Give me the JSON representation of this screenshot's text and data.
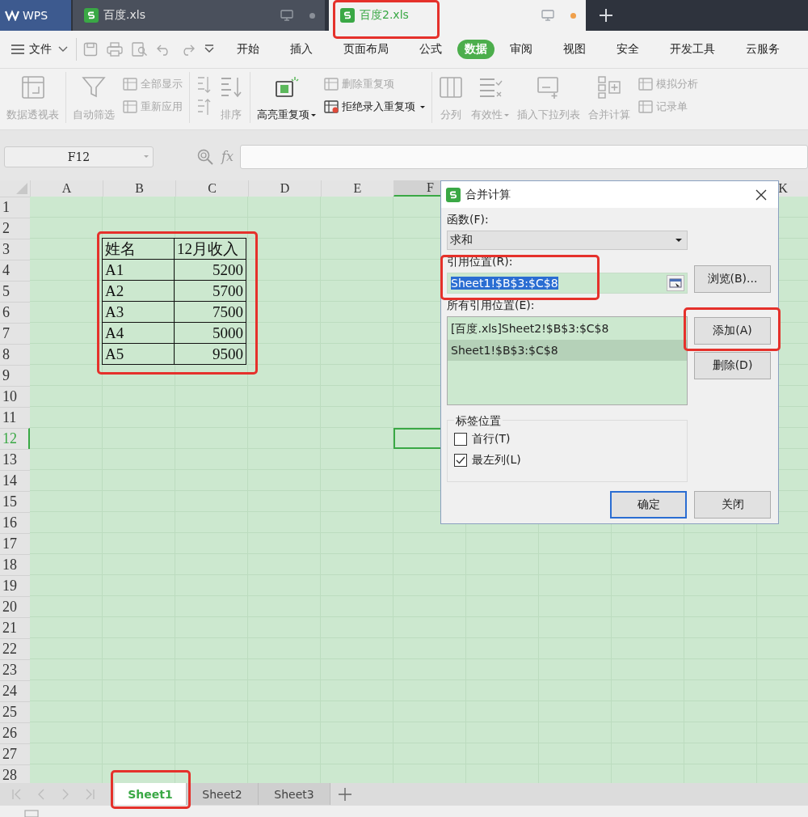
{
  "tabs": [
    {
      "kind": "home",
      "label": "WPS",
      "selected": false
    },
    {
      "kind": "file",
      "label": "百度.xls",
      "selected": false,
      "modified": false
    },
    {
      "kind": "file",
      "label": "百度2.xls",
      "selected": true,
      "modified": true
    }
  ],
  "menu": {
    "file_label": "文件",
    "ribbon_tabs": [
      {
        "label": "开始",
        "selected": false
      },
      {
        "label": "插入",
        "selected": false
      },
      {
        "label": "页面布局",
        "selected": false
      },
      {
        "label": "公式",
        "selected": false
      },
      {
        "label": "数据",
        "selected": true
      },
      {
        "label": "审阅",
        "selected": false
      },
      {
        "label": "视图",
        "selected": false
      },
      {
        "label": "安全",
        "selected": false
      },
      {
        "label": "开发工具",
        "selected": false
      },
      {
        "label": "云服务",
        "selected": false
      }
    ]
  },
  "ribbon": {
    "groups": [
      {
        "items": [
          {
            "kind": "big",
            "label": "数据透视表",
            "disabled": true,
            "dropdown": false
          }
        ]
      },
      {
        "items": [
          {
            "kind": "big",
            "label": "自动筛选",
            "disabled": true,
            "dropdown": false
          },
          {
            "kind": "stack",
            "items": [
              {
                "label": "全部显示",
                "disabled": true,
                "dropdown": false
              },
              {
                "label": "重新应用",
                "disabled": true,
                "dropdown": false
              }
            ]
          }
        ]
      },
      {
        "items": [
          {
            "kind": "sort_icons",
            "disabled": true
          },
          {
            "kind": "big",
            "label": "排序",
            "disabled": true,
            "dropdown": false
          }
        ]
      },
      {
        "items": [
          {
            "kind": "big",
            "label": "高亮重复项",
            "disabled": false,
            "dropdown": true
          },
          {
            "kind": "stack",
            "items": [
              {
                "label": "删除重复项",
                "disabled": true,
                "dropdown": false
              },
              {
                "label": "拒绝录入重复项",
                "disabled": false,
                "dropdown": true
              }
            ]
          }
        ]
      },
      {
        "items": [
          {
            "kind": "big",
            "label": "分列",
            "disabled": true,
            "dropdown": false
          },
          {
            "kind": "big",
            "label": "有效性",
            "disabled": true,
            "dropdown": true
          },
          {
            "kind": "big",
            "label": "插入下拉列表",
            "disabled": true,
            "dropdown": false
          },
          {
            "kind": "big",
            "label": "合并计算",
            "disabled": true,
            "dropdown": false
          },
          {
            "kind": "stack",
            "items": [
              {
                "label": "模拟分析",
                "disabled": true,
                "dropdown": false
              },
              {
                "label": "记录单",
                "disabled": true,
                "dropdown": false
              }
            ]
          }
        ]
      }
    ]
  },
  "formula_bar": {
    "name_box": "F12",
    "fx_label": "fx"
  },
  "sheet": {
    "columns_left": [
      {
        "label": "A",
        "selected": false
      },
      {
        "label": "B",
        "selected": false
      },
      {
        "label": "C",
        "selected": false
      },
      {
        "label": "D",
        "selected": false
      },
      {
        "label": "E",
        "selected": false
      },
      {
        "label": "F",
        "selected": true
      }
    ],
    "columns_right": [
      {
        "label": "K",
        "selected": false
      }
    ],
    "rows": [
      {
        "label": "1",
        "selected": false
      },
      {
        "label": "2",
        "selected": false
      },
      {
        "label": "3",
        "selected": false
      },
      {
        "label": "4",
        "selected": false
      },
      {
        "label": "5",
        "selected": false
      },
      {
        "label": "6",
        "selected": false
      },
      {
        "label": "7",
        "selected": false
      },
      {
        "label": "8",
        "selected": false
      },
      {
        "label": "9",
        "selected": false
      },
      {
        "label": "10",
        "selected": false
      },
      {
        "label": "11",
        "selected": false
      },
      {
        "label": "12",
        "selected": true
      },
      {
        "label": "13",
        "selected": false
      },
      {
        "label": "14",
        "selected": false
      },
      {
        "label": "15",
        "selected": false
      },
      {
        "label": "16",
        "selected": false
      },
      {
        "label": "17",
        "selected": false
      },
      {
        "label": "18",
        "selected": false
      },
      {
        "label": "19",
        "selected": false
      },
      {
        "label": "20",
        "selected": false
      },
      {
        "label": "21",
        "selected": false
      },
      {
        "label": "22",
        "selected": false
      },
      {
        "label": "23",
        "selected": false
      },
      {
        "label": "24",
        "selected": false
      },
      {
        "label": "25",
        "selected": false
      },
      {
        "label": "26",
        "selected": false
      },
      {
        "label": "27",
        "selected": false
      },
      {
        "label": "28",
        "selected": false
      }
    ],
    "table": {
      "rows": [
        [
          "姓名",
          "12月收入"
        ],
        [
          "A1",
          "5200"
        ],
        [
          "A2",
          "5700"
        ],
        [
          "A3",
          "7500"
        ],
        [
          "A4",
          "5000"
        ],
        [
          "A5",
          "9500"
        ]
      ]
    }
  },
  "dialog": {
    "title": "合并计算",
    "function_label": "函数(F):",
    "function_value": "求和",
    "reference_label": "引用位置(R):",
    "reference_value": "Sheet1!$B$3:$C$8",
    "browse_button": "浏览(B)...",
    "all_references_label": "所有引用位置(E):",
    "all_references": [
      {
        "text": "[百度.xls]Sheet2!$B$3:$C$8",
        "selected": false
      },
      {
        "text": "Sheet1!$B$3:$C$8",
        "selected": true
      }
    ],
    "add_button": "添加(A)",
    "delete_button": "删除(D)",
    "label_group": "标签位置",
    "options": [
      {
        "label": "首行(T)",
        "checked": false
      },
      {
        "label": "最左列(L)",
        "checked": true
      }
    ],
    "ok_button": "确定",
    "close_button": "关闭"
  },
  "sheet_tabs": [
    {
      "label": "Sheet1",
      "selected": true
    },
    {
      "label": "Sheet2",
      "selected": false
    },
    {
      "label": "Sheet3",
      "selected": false
    }
  ]
}
